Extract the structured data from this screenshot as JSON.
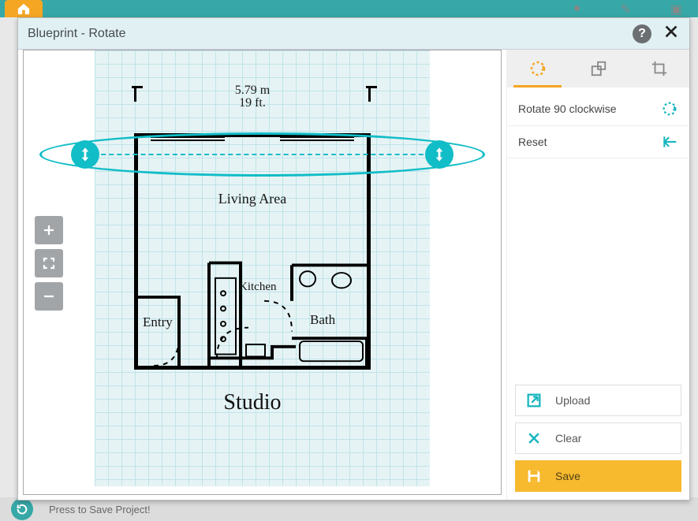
{
  "bg": {
    "status_text": "Press to Save Project!"
  },
  "dialog": {
    "title": "Blueprint - Rotate"
  },
  "plan": {
    "dim_m": "5.79 m",
    "dim_ft": "19 ft.",
    "labels": {
      "living": "Living Area",
      "kitchen": "Kitchen",
      "bath": "Bath",
      "entry": "Entry"
    },
    "title": "Studio"
  },
  "tabs": {
    "rotate": "rotate-icon",
    "scale": "scale-icon",
    "crop": "crop-icon",
    "active": "rotate"
  },
  "actions": {
    "rotate90": "Rotate 90 clockwise",
    "reset": "Reset"
  },
  "buttons": {
    "upload": "Upload",
    "clear": "Clear",
    "save": "Save"
  }
}
